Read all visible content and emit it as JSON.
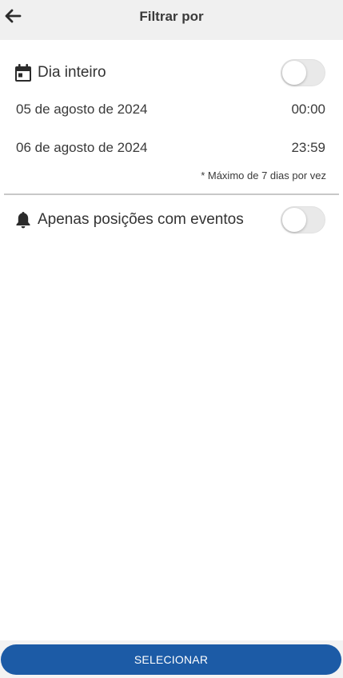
{
  "header": {
    "title": "Filtrar por",
    "back_icon": "arrow-left-icon"
  },
  "all_day": {
    "icon": "calendar-icon",
    "label": "Dia inteiro",
    "enabled": false
  },
  "start": {
    "date": "05 de agosto de 2024",
    "time": "00:00"
  },
  "end": {
    "date": "06 de agosto de 2024",
    "time": "23:59"
  },
  "note": "* Máximo de 7 dias por vez",
  "events_only": {
    "icon": "bell-icon",
    "label": "Apenas posições com eventos",
    "enabled": false
  },
  "footer": {
    "select_label": "SELECIONAR"
  },
  "colors": {
    "primary": "#1c5ba6",
    "header_bg": "#f0f0f0",
    "toggle_off": "#e9e9e9",
    "divider": "#c8c8c8"
  }
}
